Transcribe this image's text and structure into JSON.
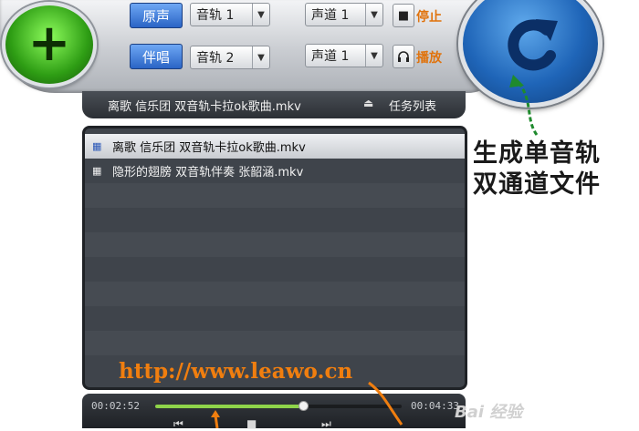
{
  "toolbar": {
    "add_icon": "plus-icon",
    "row1": {
      "mode_label": "原声",
      "track_select": "音轨 1",
      "channel_select": "声道 1",
      "action_icon": "stop-icon",
      "action_label": "停止"
    },
    "row2": {
      "mode_label": "伴唱",
      "track_select": "音轨 2",
      "channel_select": "声道 1",
      "action_icon": "headphones-icon",
      "action_label": "播放"
    },
    "convert_icon": "refresh-icon"
  },
  "file_bar": {
    "current_file": "离歌 信乐团 双音轨卡拉ok歌曲.mkv",
    "eject_icon": "eject-icon",
    "task_list_label": "任务列表"
  },
  "file_list": {
    "items": [
      {
        "name": "离歌 信乐团 双音轨卡拉ok歌曲.mkv",
        "selected": true,
        "icon": "film-icon"
      },
      {
        "name": "隐形的翅膀 双音轨伴奏 张韶涵.mkv",
        "selected": false,
        "icon": "film-icon"
      }
    ]
  },
  "transport": {
    "elapsed": "00:02:52",
    "total": "00:04:33",
    "progress": 0.6
  },
  "annotations": {
    "line1": "生成单音轨",
    "line2": "双通道文件",
    "url": "http://www.leawo.cn"
  },
  "watermark": "Bai 经验",
  "colors": {
    "accent_orange": "#f07e0f",
    "mode_blue": "#2a64c5",
    "progress_green": "#8ed34a",
    "annotation_arrow": "#1f8a2d"
  }
}
